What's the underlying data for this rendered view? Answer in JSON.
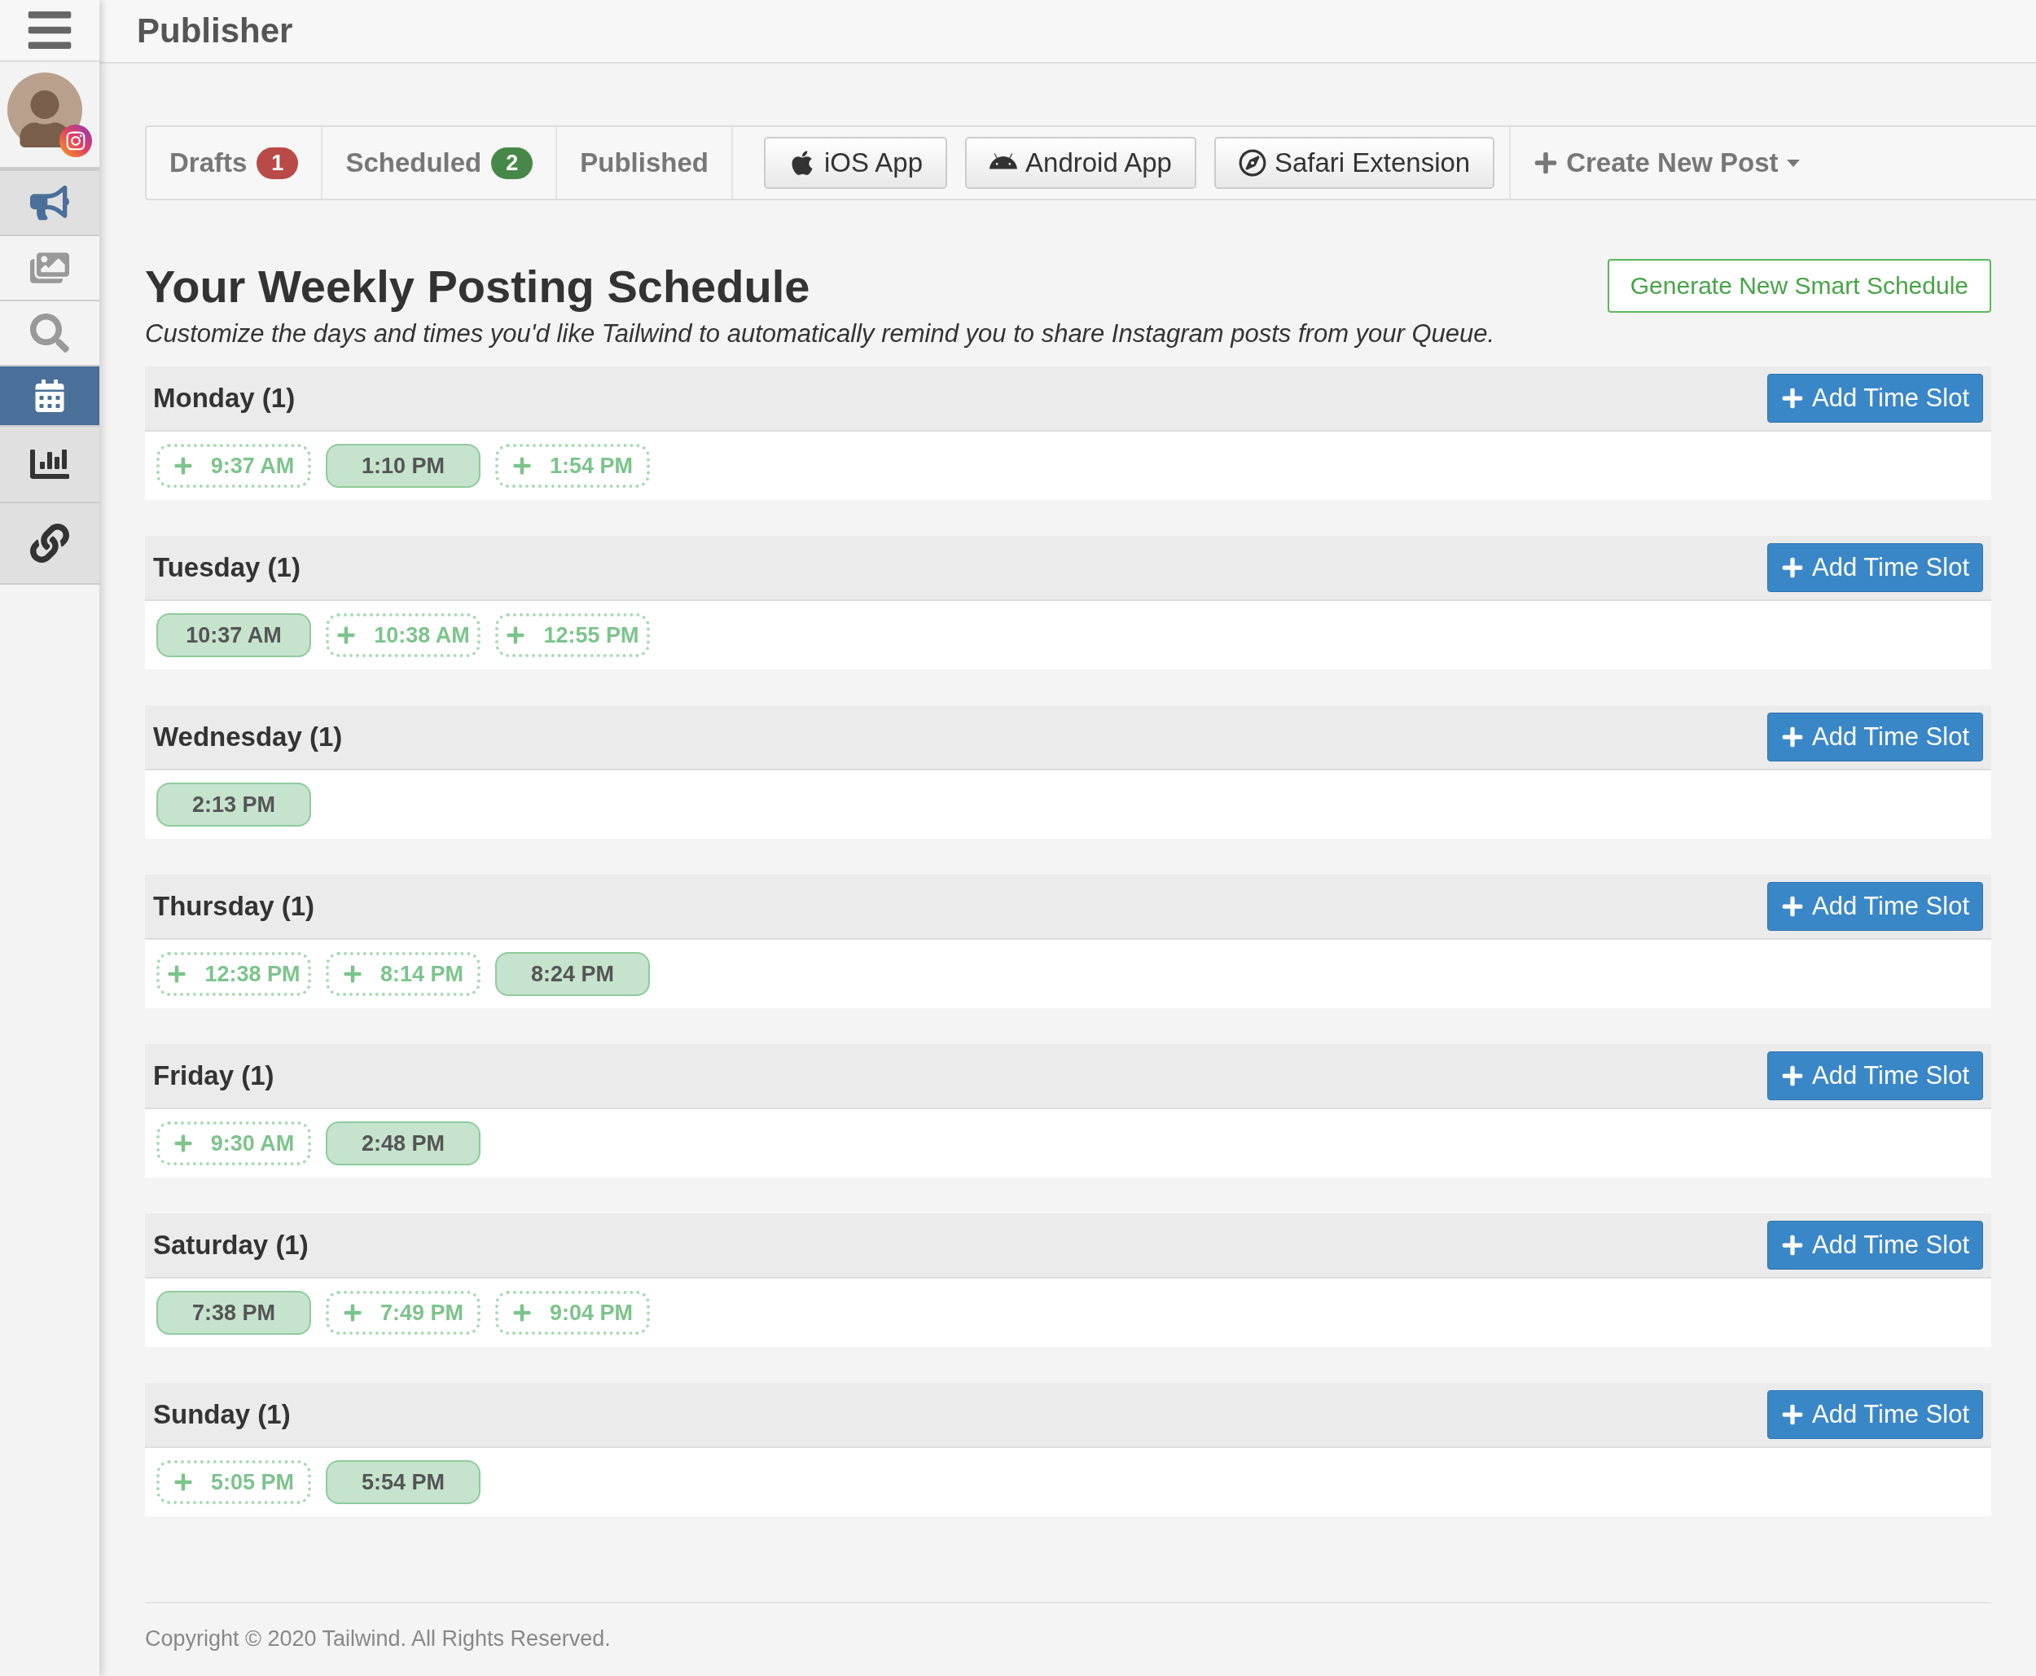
{
  "header": {
    "title": "Publisher"
  },
  "sidebar": {
    "items": [
      {
        "kind": "megaphone",
        "selected": false,
        "shaded": true
      },
      {
        "kind": "photos",
        "selected": false,
        "shaded": false
      },
      {
        "kind": "search",
        "selected": false,
        "shaded": false
      },
      {
        "kind": "calendar",
        "selected": true,
        "shaded": false
      },
      {
        "kind": "chart",
        "selected": false,
        "shaded": true
      },
      {
        "kind": "link",
        "selected": false,
        "shaded": true
      }
    ]
  },
  "tabs": [
    {
      "label": "Drafts",
      "count": "1",
      "color": "#b94a48",
      "selected": false
    },
    {
      "label": "Scheduled",
      "count": "2",
      "color": "#468847",
      "selected": false
    },
    {
      "label": "Published",
      "selected": false
    }
  ],
  "app_buttons": [
    {
      "kind": "apple",
      "label": "iOS App"
    },
    {
      "kind": "android",
      "label": "Android App"
    },
    {
      "kind": "compass",
      "label": "Safari Extension"
    }
  ],
  "create_menu": {
    "label": "Create New Post"
  },
  "schedule": {
    "title": "Your Weekly Posting Schedule",
    "subtitle": "Customize the days and times you'd like Tailwind to automatically remind you to share Instagram posts from your Queue.",
    "generate_button": "Generate New Smart Schedule",
    "days": [
      {
        "name": "Monday (1)",
        "add_button": "Add Time Slot",
        "slots": [
          {
            "time": "9:37 AM",
            "kind": "suggested"
          },
          {
            "time": "1:10 PM",
            "kind": "scheduled"
          },
          {
            "time": "1:54 PM",
            "kind": "suggested"
          }
        ]
      },
      {
        "name": "Tuesday (1)",
        "add_button": "Add Time Slot",
        "slots": [
          {
            "time": "10:37 AM",
            "kind": "scheduled"
          },
          {
            "time": "10:38 AM",
            "kind": "suggested"
          },
          {
            "time": "12:55 PM",
            "kind": "suggested"
          }
        ]
      },
      {
        "name": "Wednesday (1)",
        "add_button": "Add Time Slot",
        "slots": [
          {
            "time": "2:13 PM",
            "kind": "scheduled"
          }
        ]
      },
      {
        "name": "Thursday (1)",
        "add_button": "Add Time Slot",
        "slots": [
          {
            "time": "12:38 PM",
            "kind": "suggested"
          },
          {
            "time": "8:14 PM",
            "kind": "suggested"
          },
          {
            "time": "8:24 PM",
            "kind": "scheduled"
          }
        ]
      },
      {
        "name": "Friday (1)",
        "add_button": "Add Time Slot",
        "slots": [
          {
            "time": "9:30 AM",
            "kind": "suggested"
          },
          {
            "time": "2:48 PM",
            "kind": "scheduled"
          }
        ]
      },
      {
        "name": "Saturday (1)",
        "add_button": "Add Time Slot",
        "slots": [
          {
            "time": "7:38 PM",
            "kind": "scheduled"
          },
          {
            "time": "7:49 PM",
            "kind": "suggested"
          },
          {
            "time": "9:04 PM",
            "kind": "suggested"
          }
        ]
      },
      {
        "name": "Sunday (1)",
        "add_button": "Add Time Slot",
        "slots": [
          {
            "time": "5:05 PM",
            "kind": "suggested"
          },
          {
            "time": "5:54 PM",
            "kind": "scheduled"
          }
        ]
      }
    ]
  },
  "footer": {
    "text": "Copyright © 2020 Tailwind. All Rights Reserved."
  }
}
